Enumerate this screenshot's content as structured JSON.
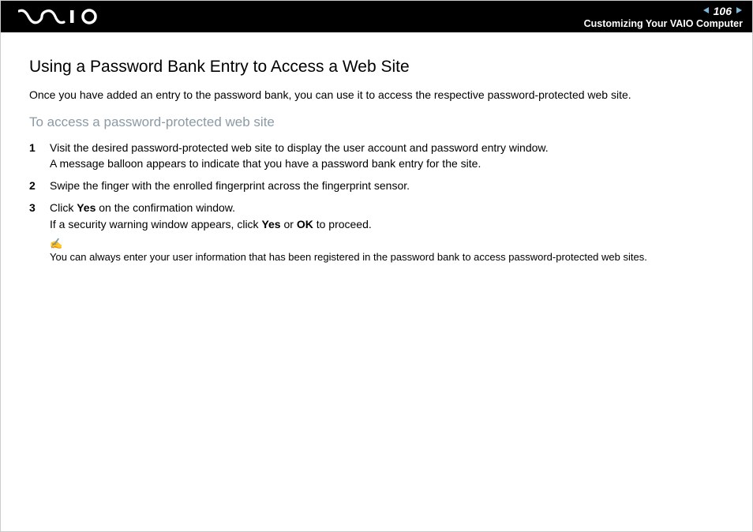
{
  "header": {
    "page_number": "106",
    "breadcrumb": "Customizing Your VAIO Computer"
  },
  "content": {
    "title": "Using a Password Bank Entry to Access a Web Site",
    "intro": "Once you have added an entry to the password bank, you can use it to access the respective password-protected web site.",
    "subtitle": "To access a password-protected web site",
    "steps": [
      {
        "num": "1",
        "line1": "Visit the desired password-protected web site to display the user account and password entry window.",
        "line2": "A message balloon appears to indicate that you have a password bank entry for the site."
      },
      {
        "num": "2",
        "line1": "Swipe the finger with the enrolled fingerprint across the fingerprint sensor."
      },
      {
        "num": "3",
        "pre1": "Click ",
        "b1": "Yes",
        "post1": " on the confirmation window.",
        "line2_pre": "If a security warning window appears, click ",
        "line2_b1": "Yes",
        "line2_mid": " or ",
        "line2_b2": "OK",
        "line2_post": " to proceed."
      }
    ],
    "note": {
      "icon": "✍",
      "text": "You can always enter your user information that has been registered in the password bank to access password-protected web sites."
    }
  }
}
